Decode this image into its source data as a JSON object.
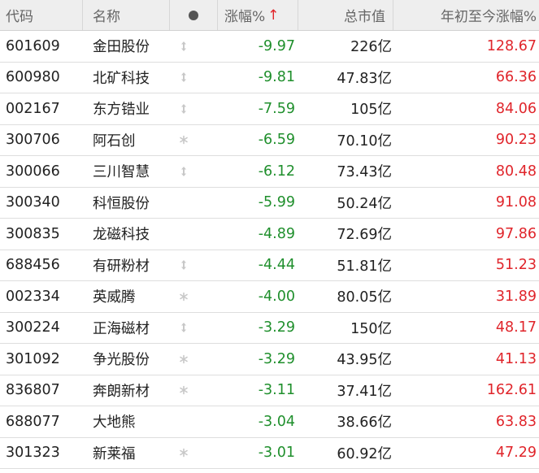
{
  "header": {
    "code": "代码",
    "name": "名称",
    "change": "涨幅%",
    "sort_arrow": "↑",
    "cap": "总市值",
    "ytd": "年初至今涨幅%"
  },
  "colors": {
    "down": "#1f8f2c",
    "up": "#e0252b",
    "header_bg": "#eeeeee"
  },
  "rows": [
    {
      "code": "601609",
      "name": "金田股份",
      "mark": "updown-icon",
      "change": "-9.97",
      "cap": "226亿",
      "ytd": "128.67"
    },
    {
      "code": "600980",
      "name": "北矿科技",
      "mark": "updown-icon",
      "change": "-9.81",
      "cap": "47.83亿",
      "ytd": "66.36"
    },
    {
      "code": "002167",
      "name": "东方锆业",
      "mark": "updown-icon",
      "change": "-7.59",
      "cap": "105亿",
      "ytd": "84.06"
    },
    {
      "code": "300706",
      "name": "阿石创",
      "mark": "asterisk-icon",
      "change": "-6.59",
      "cap": "70.10亿",
      "ytd": "90.23"
    },
    {
      "code": "300066",
      "name": "三川智慧",
      "mark": "updown-icon",
      "change": "-6.12",
      "cap": "73.43亿",
      "ytd": "80.48"
    },
    {
      "code": "300340",
      "name": "科恒股份",
      "mark": "",
      "change": "-5.99",
      "cap": "50.24亿",
      "ytd": "91.08"
    },
    {
      "code": "300835",
      "name": "龙磁科技",
      "mark": "",
      "change": "-4.89",
      "cap": "72.69亿",
      "ytd": "97.86"
    },
    {
      "code": "688456",
      "name": "有研粉材",
      "mark": "updown-icon",
      "change": "-4.44",
      "cap": "51.81亿",
      "ytd": "51.23"
    },
    {
      "code": "002334",
      "name": "英威腾",
      "mark": "asterisk-icon",
      "change": "-4.00",
      "cap": "80.05亿",
      "ytd": "31.89"
    },
    {
      "code": "300224",
      "name": "正海磁材",
      "mark": "updown-icon",
      "change": "-3.29",
      "cap": "150亿",
      "ytd": "48.17"
    },
    {
      "code": "301092",
      "name": "争光股份",
      "mark": "asterisk-icon",
      "change": "-3.29",
      "cap": "43.95亿",
      "ytd": "41.13"
    },
    {
      "code": "836807",
      "name": "奔朗新材",
      "mark": "asterisk-icon",
      "change": "-3.11",
      "cap": "37.41亿",
      "ytd": "162.61"
    },
    {
      "code": "688077",
      "name": "大地熊",
      "mark": "",
      "change": "-3.04",
      "cap": "38.66亿",
      "ytd": "63.83"
    },
    {
      "code": "301323",
      "name": "新莱福",
      "mark": "asterisk-icon",
      "change": "-3.01",
      "cap": "60.92亿",
      "ytd": "47.29"
    }
  ]
}
